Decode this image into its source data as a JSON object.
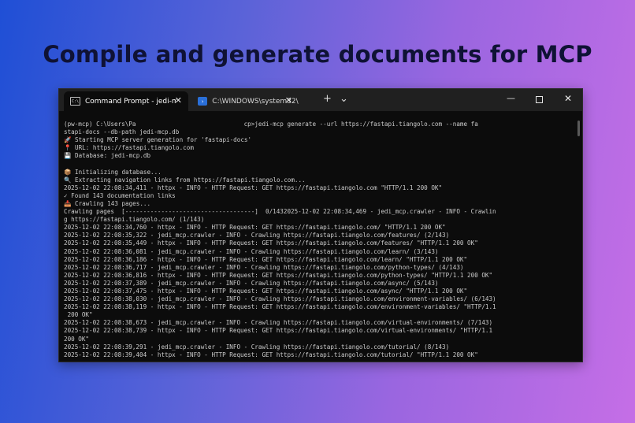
{
  "headline": "Compile and generate documents for MCP",
  "window": {
    "tabs": [
      {
        "label": "Command Prompt - jedi-mcp",
        "icon": "cmd-icon",
        "close": "✕"
      },
      {
        "label": "C:\\WINDOWS\\system32\\cmd.e",
        "icon": "powershell-icon",
        "close": "✕"
      }
    ],
    "new_tab": "+",
    "dropdown": "⌄",
    "minimize": "—",
    "close": "✕"
  },
  "terminal": {
    "lines": [
      "(pw-mcp) C:\\Users\\Pa                              cp>jedi-mcp generate --url https://fastapi.tiangolo.com --name fa",
      "stapi-docs --db-path jedi-mcp.db",
      "🚀 Starting MCP server generation for 'fastapi-docs'",
      "📍 URL: https://fastapi.tiangolo.com",
      "💾 Database: jedi-mcp.db",
      "",
      "📦 Initializing database...",
      "🔍 Extracting navigation links from https://fastapi.tiangolo.com...",
      "2025-12-02 22:08:34,411 - httpx - INFO - HTTP Request: GET https://fastapi.tiangolo.com \"HTTP/1.1 200 OK\"",
      "✓ Found 143 documentation links",
      "📥 Crawling 143 pages...",
      "Crawling pages  [------------------------------------]  0/1432025-12-02 22:08:34,469 - jedi_mcp.crawler - INFO - Crawlin",
      "g https://fastapi.tiangolo.com/ (1/143)",
      "2025-12-02 22:08:34,760 - httpx - INFO - HTTP Request: GET https://fastapi.tiangolo.com/ \"HTTP/1.1 200 OK\"",
      "2025-12-02 22:08:35,322 - jedi_mcp.crawler - INFO - Crawling https://fastapi.tiangolo.com/features/ (2/143)",
      "2025-12-02 22:08:35,449 - httpx - INFO - HTTP Request: GET https://fastapi.tiangolo.com/features/ \"HTTP/1.1 200 OK\"",
      "2025-12-02 22:08:36,081 - jedi_mcp.crawler - INFO - Crawling https://fastapi.tiangolo.com/learn/ (3/143)",
      "2025-12-02 22:08:36,186 - httpx - INFO - HTTP Request: GET https://fastapi.tiangolo.com/learn/ \"HTTP/1.1 200 OK\"",
      "2025-12-02 22:08:36,717 - jedi_mcp.crawler - INFO - Crawling https://fastapi.tiangolo.com/python-types/ (4/143)",
      "2025-12-02 22:08:36,816 - httpx - INFO - HTTP Request: GET https://fastapi.tiangolo.com/python-types/ \"HTTP/1.1 200 OK\"",
      "2025-12-02 22:08:37,389 - jedi_mcp.crawler - INFO - Crawling https://fastapi.tiangolo.com/async/ (5/143)",
      "2025-12-02 22:08:37,475 - httpx - INFO - HTTP Request: GET https://fastapi.tiangolo.com/async/ \"HTTP/1.1 200 OK\"",
      "2025-12-02 22:08:38,030 - jedi_mcp.crawler - INFO - Crawling https://fastapi.tiangolo.com/environment-variables/ (6/143)",
      "2025-12-02 22:08:38,119 - httpx - INFO - HTTP Request: GET https://fastapi.tiangolo.com/environment-variables/ \"HTTP/1.1",
      " 200 OK\"",
      "2025-12-02 22:08:38,673 - jedi_mcp.crawler - INFO - Crawling https://fastapi.tiangolo.com/virtual-environments/ (7/143)",
      "2025-12-02 22:08:38,739 - httpx - INFO - HTTP Request: GET https://fastapi.tiangolo.com/virtual-environments/ \"HTTP/1.1",
      "200 OK\"",
      "2025-12-02 22:08:39,291 - jedi_mcp.crawler - INFO - Crawling https://fastapi.tiangolo.com/tutorial/ (8/143)",
      "2025-12-02 22:08:39,404 - httpx - INFO - HTTP Request: GET https://fastapi.tiangolo.com/tutorial/ \"HTTP/1.1 200 OK\""
    ]
  }
}
